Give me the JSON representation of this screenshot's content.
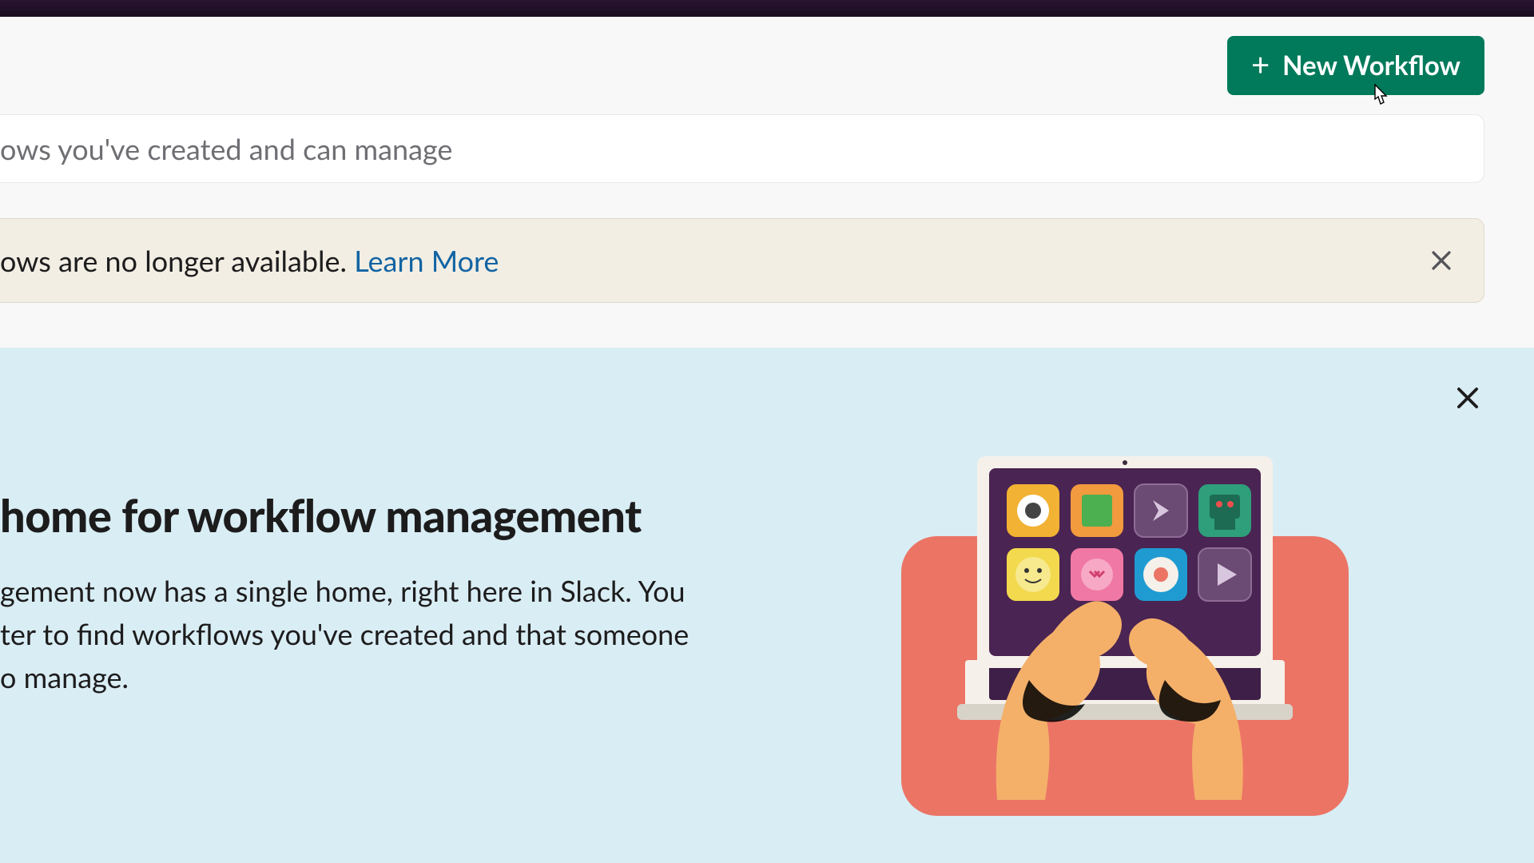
{
  "colors": {
    "primary_button": "#007a5a",
    "link": "#1264a3",
    "notice_bg": "#f2eee4",
    "promo_bg": "#d9edf4"
  },
  "header": {
    "new_workflow_label": "New Workflow"
  },
  "filter": {
    "text_fragment": "ows you've created and can manage"
  },
  "notice": {
    "text_fragment": "ows are no longer available. ",
    "link_label": "Learn More"
  },
  "promo": {
    "title_fragment": "home for workflow management",
    "body_line1": "gement now has a single home, right here in Slack. You",
    "body_line2": "ter to find workflows you've created and that someone",
    "body_line3": "o manage."
  }
}
